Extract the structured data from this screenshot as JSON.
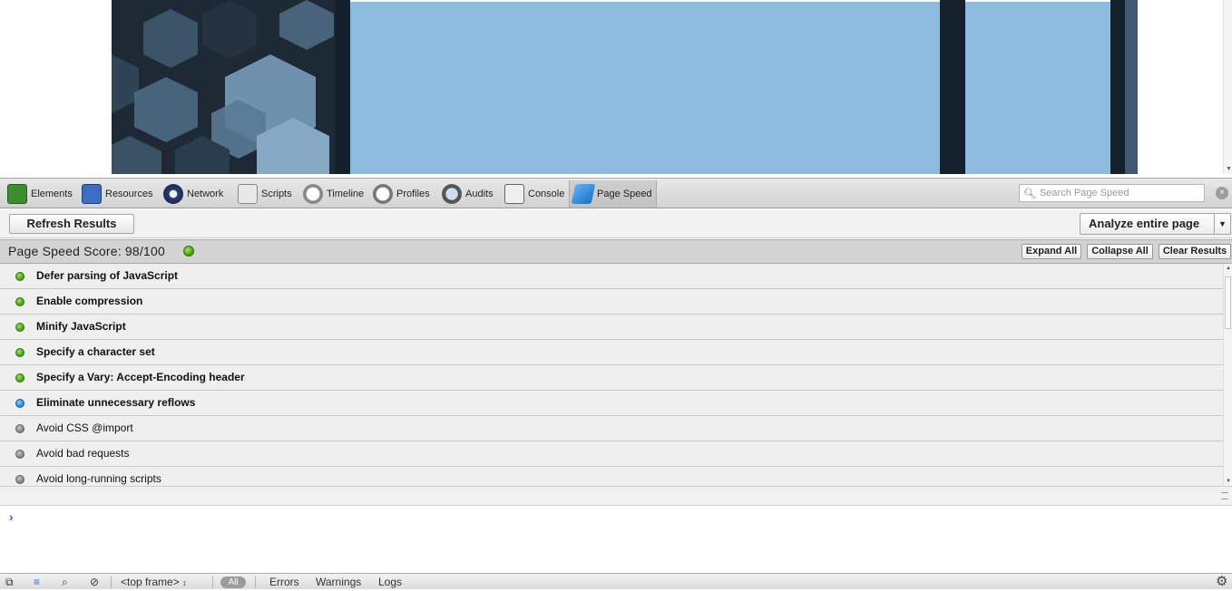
{
  "toolbar": {
    "tabs": [
      {
        "label": "Elements",
        "icon": "elements-icon"
      },
      {
        "label": "Resources",
        "icon": "resources-icon"
      },
      {
        "label": "Network",
        "icon": "network-icon"
      },
      {
        "label": "Scripts",
        "icon": "scripts-icon"
      },
      {
        "label": "Timeline",
        "icon": "timeline-icon"
      },
      {
        "label": "Profiles",
        "icon": "profiles-icon"
      },
      {
        "label": "Audits",
        "icon": "audits-icon"
      },
      {
        "label": "Console",
        "icon": "console-icon"
      },
      {
        "label": "Page Speed",
        "icon": "page-speed-icon",
        "active": true
      }
    ],
    "search_placeholder": "Search Page Speed",
    "close_icon": "close-icon"
  },
  "actions": {
    "refresh_label": "Refresh Results",
    "analyze_label": "Analyze entire page"
  },
  "score": {
    "text": "Page Speed Score: 98/100",
    "status_color": "#3c9a12",
    "expand_label": "Expand All",
    "collapse_label": "Collapse All",
    "clear_label": "Clear Results"
  },
  "rules": [
    {
      "label": "Defer parsing of JavaScript",
      "status": "green",
      "bold": true
    },
    {
      "label": "Enable compression",
      "status": "green",
      "bold": true
    },
    {
      "label": "Minify JavaScript",
      "status": "green",
      "bold": true
    },
    {
      "label": "Specify a character set",
      "status": "green",
      "bold": true
    },
    {
      "label": "Specify a Vary: Accept-Encoding header",
      "status": "green",
      "bold": true
    },
    {
      "label": "Eliminate unnecessary reflows",
      "status": "blue",
      "bold": true
    },
    {
      "label": "Avoid CSS @import",
      "status": "gray",
      "bold": false
    },
    {
      "label": "Avoid bad requests",
      "status": "gray",
      "bold": false
    },
    {
      "label": "Avoid long-running scripts",
      "status": "gray",
      "bold": false
    }
  ],
  "console": {
    "prompt": "›"
  },
  "statusbar": {
    "frame_label": "<top frame>",
    "all_label": "All",
    "errors_label": "Errors",
    "warnings_label": "Warnings",
    "logs_label": "Logs"
  }
}
